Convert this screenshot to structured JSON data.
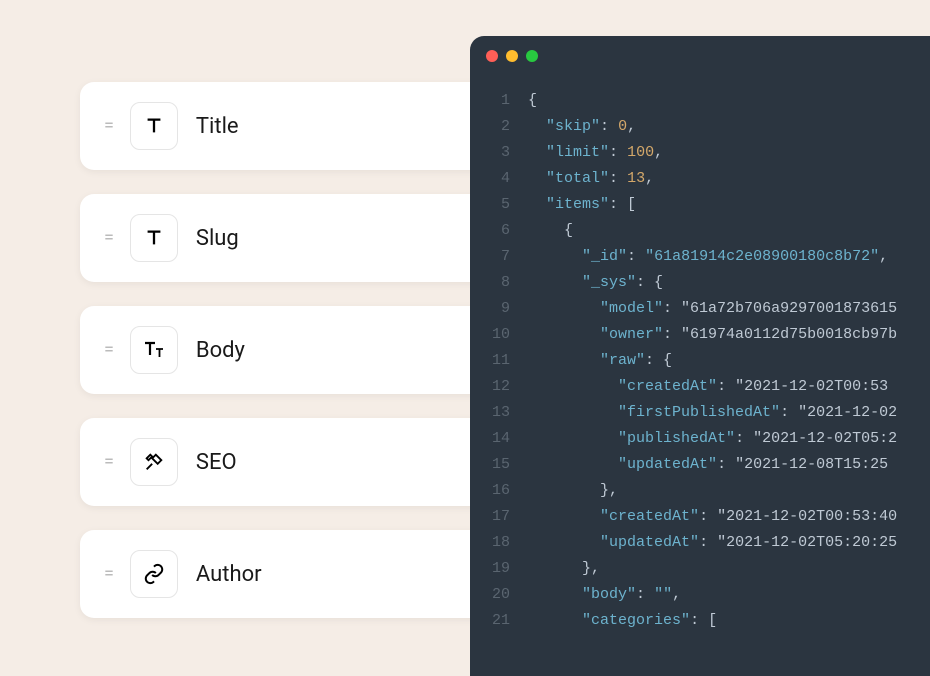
{
  "fields": [
    {
      "label": "Title",
      "icon": "title-icon"
    },
    {
      "label": "Slug",
      "icon": "title-icon"
    },
    {
      "label": "Body",
      "icon": "richtext-icon"
    },
    {
      "label": "SEO",
      "icon": "tools-icon"
    },
    {
      "label": "Author",
      "icon": "link-icon"
    }
  ],
  "code": {
    "lines": [
      "{",
      "  \"skip\": 0,",
      "  \"limit\": 100,",
      "  \"total\": 13,",
      "  \"items\": [",
      "    {",
      "      \"_id\": \"61a81914c2e08900180c8b72\",",
      "      \"_sys\": {",
      "        \"model\": \"61a72b706a9297001873615",
      "        \"owner\": \"61974a0112d75b0018cb97b",
      "        \"raw\": {",
      "          \"createdAt\": \"2021-12-02T00:53",
      "          \"firstPublishedAt\": \"2021-12-02",
      "          \"publishedAt\": \"2021-12-02T05:2",
      "          \"updatedAt\": \"2021-12-08T15:25",
      "        },",
      "        \"createdAt\": \"2021-12-02T00:53:40",
      "        \"updatedAt\": \"2021-12-02T05:20:25",
      "      },",
      "      \"body\": \"\",",
      "      \"categories\": ["
    ]
  }
}
